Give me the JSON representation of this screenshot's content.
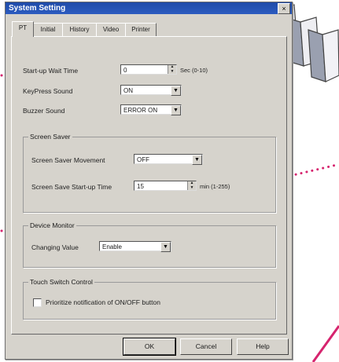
{
  "dialog": {
    "title": "System Setting",
    "close_glyph": "×"
  },
  "tabs": [
    {
      "label": "PT",
      "active": true
    },
    {
      "label": "Initial",
      "active": false
    },
    {
      "label": "History",
      "active": false
    },
    {
      "label": "Video",
      "active": false
    },
    {
      "label": "Printer",
      "active": false
    }
  ],
  "fields": {
    "startup_wait": {
      "label": "Start-up Wait Time",
      "value": "0",
      "unit": "Sec (0-10)"
    },
    "keypress_sound": {
      "label": "KeyPress Sound",
      "value": "ON"
    },
    "buzzer_sound": {
      "label": "Buzzer Sound",
      "value": "ERROR ON"
    }
  },
  "screen_saver": {
    "title": "Screen Saver",
    "movement": {
      "label": "Screen Saver Movement",
      "value": "OFF"
    },
    "startup_time": {
      "label": "Screen Save Start-up Time",
      "value": "15",
      "unit": "min (1-255)"
    }
  },
  "device_monitor": {
    "title": "Device Monitor",
    "changing_value": {
      "label": "Changing Value",
      "value": "Enable"
    }
  },
  "touch_switch": {
    "title": "Touch Switch Control",
    "prioritize": {
      "label": "Prioritize notification of ON/OFF button",
      "checked": false
    }
  },
  "buttons": {
    "ok": "OK",
    "cancel": "Cancel",
    "help": "Help"
  },
  "icons": {
    "dropdown": "▼",
    "spin_up": "▲",
    "spin_down": "▼"
  },
  "colors": {
    "titlebar": "#1e4aa8",
    "dots": "#d6246e",
    "dialog_bg": "#d6d3cc"
  }
}
